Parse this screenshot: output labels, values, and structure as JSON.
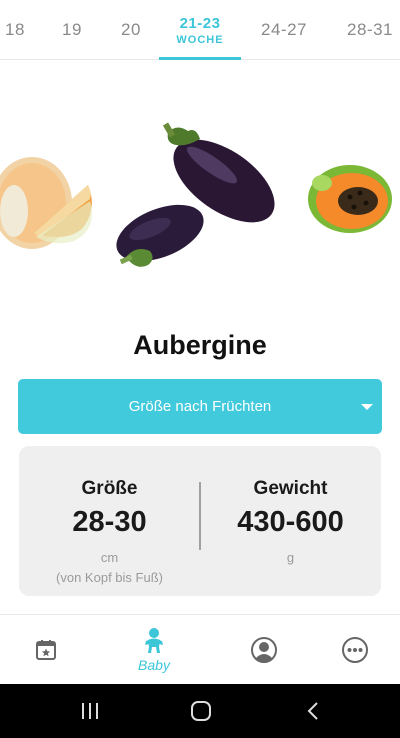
{
  "weeks": [
    {
      "num": "18",
      "sub": ""
    },
    {
      "num": "19",
      "sub": ""
    },
    {
      "num": "20",
      "sub": ""
    },
    {
      "num": "21-23",
      "sub": "WOCHE"
    },
    {
      "num": "24-27",
      "sub": ""
    },
    {
      "num": "28-31",
      "sub": ""
    }
  ],
  "active_week_index": 3,
  "fruit": {
    "name": "Aubergine",
    "images": [
      "melon",
      "eggplant",
      "papaya"
    ]
  },
  "selector": {
    "label": "Größe nach Früchten",
    "icon": "chevron-down-icon"
  },
  "stats": {
    "size": {
      "label": "Größe",
      "value": "28-30",
      "unit": "cm",
      "note": "(von Kopf bis Fuß)"
    },
    "weight": {
      "label": "Gewicht",
      "value": "430-600",
      "unit": "g"
    }
  },
  "nav": {
    "items": [
      {
        "icon": "calendar-icon",
        "label": ""
      },
      {
        "icon": "baby-icon",
        "label": "Baby"
      },
      {
        "icon": "profile-icon",
        "label": ""
      },
      {
        "icon": "more-icon",
        "label": ""
      }
    ],
    "active_index": 1
  },
  "colors": {
    "accent": "#3cc6d8",
    "card": "#efefef"
  }
}
